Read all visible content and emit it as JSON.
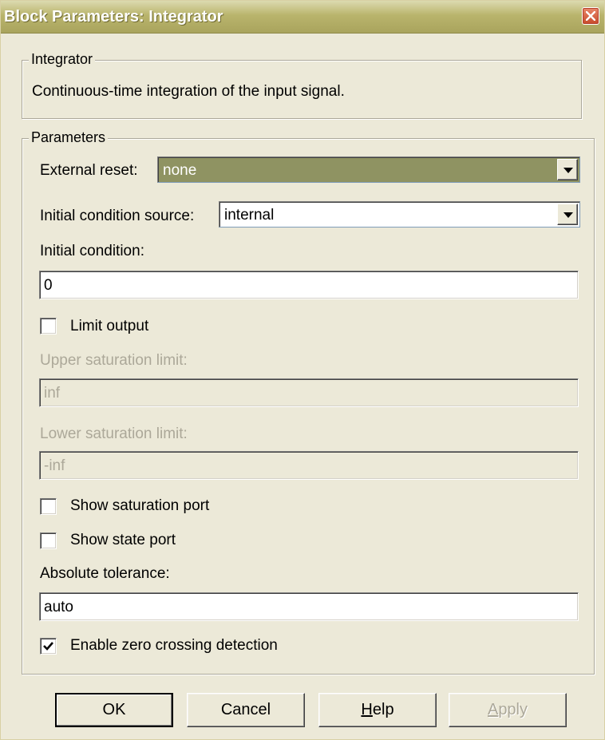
{
  "window": {
    "title": "Block Parameters: Integrator"
  },
  "integrator_group": {
    "legend": "Integrator",
    "description": "Continuous-time integration of the input signal."
  },
  "parameters": {
    "legend": "Parameters",
    "external_reset": {
      "label": "External reset:",
      "value": "none"
    },
    "initial_condition_source": {
      "label": "Initial condition source:",
      "value": "internal"
    },
    "initial_condition": {
      "label": "Initial condition:",
      "value": "0"
    },
    "limit_output": {
      "label": "Limit output",
      "checked": false
    },
    "upper_saturation": {
      "label": "Upper saturation limit:",
      "value": "inf",
      "enabled": false
    },
    "lower_saturation": {
      "label": "Lower saturation limit:",
      "value": "-inf",
      "enabled": false
    },
    "show_saturation_port": {
      "label": "Show saturation port",
      "checked": false
    },
    "show_state_port": {
      "label": "Show state port",
      "checked": false
    },
    "absolute_tolerance": {
      "label": "Absolute tolerance:",
      "value": "auto"
    },
    "zero_crossing": {
      "label": "Enable zero crossing detection",
      "checked": true
    }
  },
  "buttons": {
    "ok": "OK",
    "cancel": "Cancel",
    "help_mnemonic": "H",
    "help_rest": "elp",
    "apply_mnemonic": "A",
    "apply_rest": "pply"
  },
  "icons": {
    "close": "close-icon",
    "dropdown": "chevron-down-icon",
    "check": "checkmark-icon"
  },
  "colors": {
    "titlebar": "#b9b46c",
    "dialog_bg": "#ece9d8",
    "selected_combo": "#8f9362",
    "close_button": "#c74a2a"
  }
}
